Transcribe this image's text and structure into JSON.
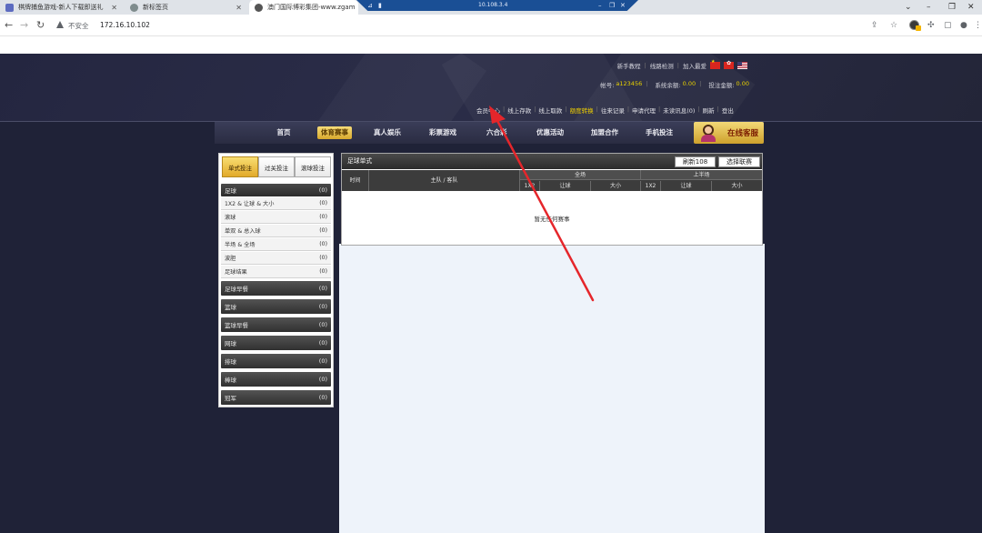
{
  "browser": {
    "tabs": [
      {
        "title": "棋牌捕鱼游戏-新人下载即送礼",
        "favicon_color": "#5c6bc0"
      },
      {
        "title": "新标签页",
        "favicon_color": "#7f8c8d"
      },
      {
        "title": "澳门国际博彩集团-www.zgam",
        "favicon_color": "#555555"
      }
    ],
    "remote_ip": "10.108.3.4",
    "insecure_label": "不安全",
    "url": "172.16.10.102"
  },
  "header": {
    "top_links": [
      "新手教程",
      "线路检测",
      "加入最爱"
    ],
    "account": {
      "label": "帐号:",
      "value": "a123456",
      "balance_label": "系统余额:",
      "balance": "0.00",
      "bet_label": "投注金额:",
      "bet": "0.00"
    },
    "user_links": [
      {
        "label": "会员中心",
        "highlight": false
      },
      {
        "label": "线上存款",
        "highlight": false
      },
      {
        "label": "线上取款",
        "highlight": false
      },
      {
        "label": "额度转换",
        "highlight": true
      },
      {
        "label": "往来记录",
        "highlight": false
      },
      {
        "label": "申请代理",
        "highlight": false
      },
      {
        "label": "未读讯息(0)",
        "highlight": false
      },
      {
        "label": "刷新",
        "highlight": false
      },
      {
        "label": "登出",
        "highlight": false
      }
    ]
  },
  "nav": {
    "items": [
      "首页",
      "体育赛事",
      "真人娱乐",
      "彩票游戏",
      "六合彩",
      "优惠活动",
      "加盟合作",
      "手机投注"
    ],
    "active_index": 1,
    "service_label": "在线客服"
  },
  "left_panel": {
    "bet_tabs": [
      "单式投注",
      "过关投注",
      "滚球投注"
    ],
    "active_tab": 0,
    "football_header": {
      "label": "足球",
      "count": "(0)"
    },
    "football_items": [
      {
        "label": "1X2 & 让球 & 大小",
        "count": "(0)"
      },
      {
        "label": "滚球",
        "count": "(0)"
      },
      {
        "label": "单双 & 总入球",
        "count": "(0)"
      },
      {
        "label": "半场 & 全场",
        "count": "(0)"
      },
      {
        "label": "波胆",
        "count": "(0)"
      },
      {
        "label": "足球结果",
        "count": "(0)"
      }
    ],
    "groups": [
      {
        "label": "足球早餐",
        "count": "(0)"
      },
      {
        "label": "篮球",
        "count": "(0)"
      },
      {
        "label": "篮球早餐",
        "count": "(0)"
      },
      {
        "label": "网球",
        "count": "(0)"
      },
      {
        "label": "排球",
        "count": "(0)"
      },
      {
        "label": "棒球",
        "count": "(0)"
      },
      {
        "label": "冠军",
        "count": "(0)"
      }
    ]
  },
  "right_panel": {
    "title": "足球单式",
    "refresh_label": "刷新108",
    "select_label": "选择联赛",
    "columns": {
      "time": "时间",
      "teams": "主队 / 客队",
      "full_time": "全场",
      "first_half": "上半场",
      "sub": [
        "1X2",
        "让球",
        "大小"
      ]
    },
    "empty_message": "暂无任何赛事"
  }
}
